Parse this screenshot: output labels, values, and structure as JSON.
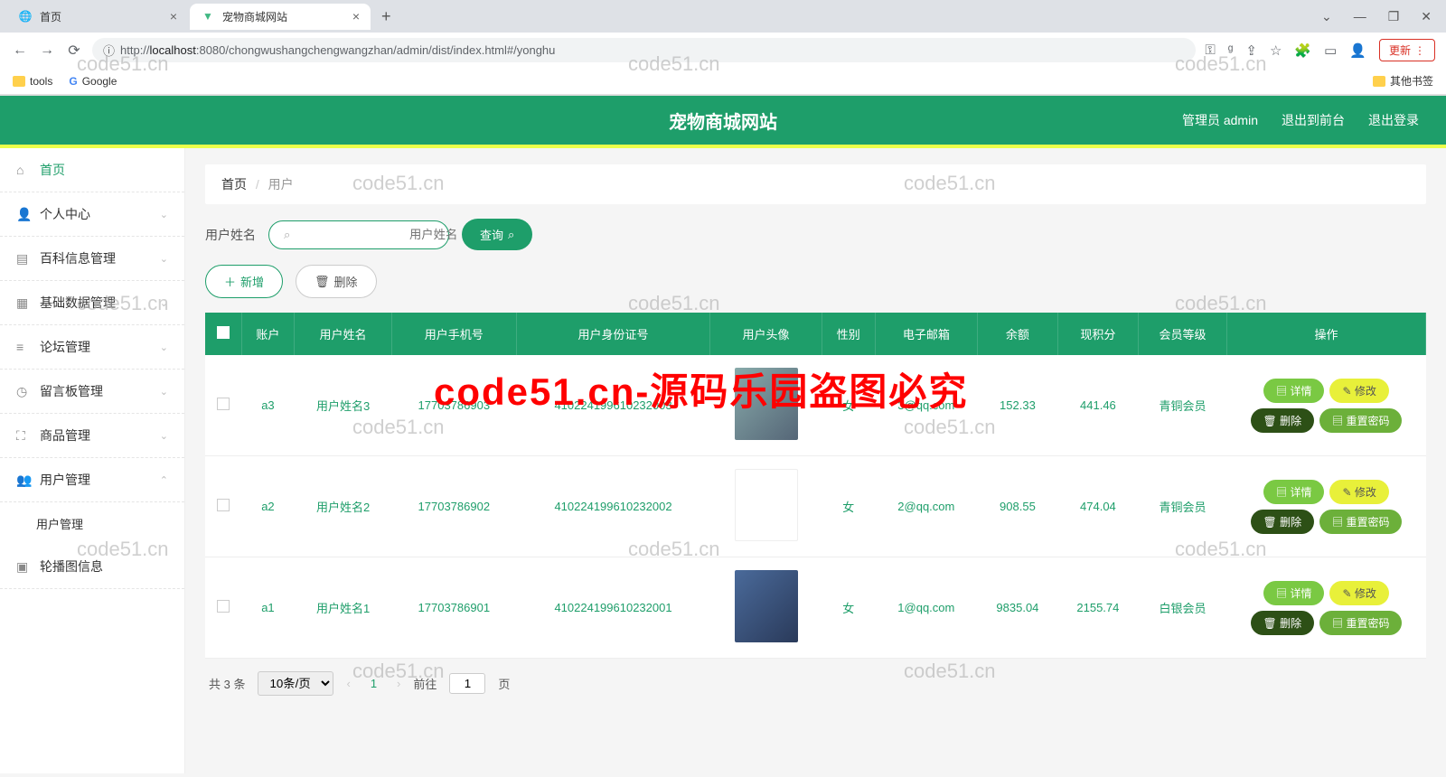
{
  "browser": {
    "tabs": [
      {
        "title": "首页",
        "active": false
      },
      {
        "title": "宠物商城网站",
        "active": true
      }
    ],
    "url_prefix": "http://",
    "url_host": "localhost",
    "url_port": ":8080",
    "url_path": "/chongwushangchengwangzhan/admin/dist/index.html#/yonghu",
    "update_label": "更新",
    "bookmarks": {
      "tools": "tools",
      "google": "Google",
      "other": "其他书签"
    }
  },
  "header": {
    "title": "宠物商城网站",
    "admin_label": "管理员 admin",
    "exit_front": "退出到前台",
    "logout": "退出登录"
  },
  "sidebar": {
    "home": "首页",
    "personal": "个人中心",
    "baike": "百科信息管理",
    "basic": "基础数据管理",
    "forum": "论坛管理",
    "message": "留言板管理",
    "goods": "商品管理",
    "user": "用户管理",
    "user_sub": "用户管理",
    "carousel": "轮播图信息"
  },
  "breadcrumb": {
    "home": "首页",
    "current": "用户"
  },
  "search": {
    "label": "用户姓名",
    "placeholder": "用户姓名",
    "btn": "查询"
  },
  "actions": {
    "add": "新增",
    "delete": "删除"
  },
  "table": {
    "headers": [
      "账户",
      "用户姓名",
      "用户手机号",
      "用户身份证号",
      "用户头像",
      "性别",
      "电子邮箱",
      "余额",
      "现积分",
      "会员等级",
      "操作"
    ],
    "btn_view": "详情",
    "btn_edit": "修改",
    "btn_del": "删除",
    "btn_reset": "重置密码",
    "rows": [
      {
        "account": "a3",
        "name": "用户姓名3",
        "phone": "17703786903",
        "idcard": "410224199610232003",
        "gender": "女",
        "email": "3@qq.com",
        "balance": "152.33",
        "points": "441.46",
        "level": "青铜会员"
      },
      {
        "account": "a2",
        "name": "用户姓名2",
        "phone": "17703786902",
        "idcard": "410224199610232002",
        "gender": "女",
        "email": "2@qq.com",
        "balance": "908.55",
        "points": "474.04",
        "level": "青铜会员"
      },
      {
        "account": "a1",
        "name": "用户姓名1",
        "phone": "17703786901",
        "idcard": "410224199610232001",
        "gender": "女",
        "email": "1@qq.com",
        "balance": "9835.04",
        "points": "2155.74",
        "level": "白银会员"
      }
    ]
  },
  "pager": {
    "total": "共 3 条",
    "pagesize": "10条/页",
    "goto": "前往",
    "page_input": "1",
    "page_suffix": "页",
    "current": "1"
  },
  "watermarks": {
    "text": "code51.cn",
    "red": "code51.cn-源码乐园盗图必究"
  }
}
